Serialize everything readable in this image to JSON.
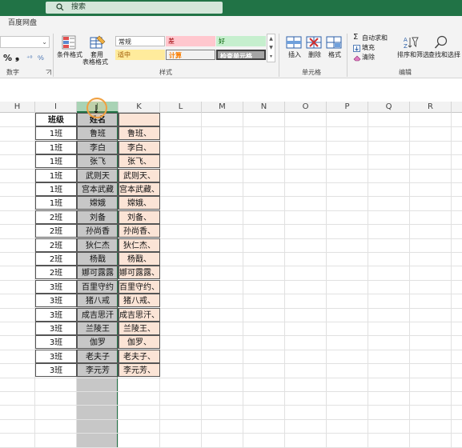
{
  "search": {
    "label": "搜索",
    "icon": "search-icon"
  },
  "menu": {
    "tab": "百度网盘"
  },
  "ribbon": {
    "combo_arrow": "⌄",
    "number": {
      "pct": "%",
      "comma": "❟",
      "inc": "⁺⁰",
      "dec": "⁰⁄₀",
      "label": "数字"
    },
    "cond_format": "条件格式",
    "table_format_1": "套用",
    "table_format_2": "表格格式",
    "styles": {
      "normal": "常规",
      "bad": "差",
      "good": "好",
      "neutral": "适中",
      "calc": "计算",
      "check": "检查单元格",
      "label": "样式"
    },
    "cells": {
      "insert": "插入",
      "delete": "删除",
      "format": "格式",
      "label": "单元格"
    },
    "editing": {
      "autosum": "自动求和",
      "fill": "填充",
      "clear": "清除",
      "sort": "排序和筛选",
      "find": "查找和选择",
      "label": "编辑"
    },
    "colors": {
      "accent": "#217346",
      "bad_bg": "#ffc7ce",
      "good_bg": "#c6efce",
      "neutral_bg": "#ffeb9c"
    }
  },
  "columns": [
    "H",
    "I",
    "J",
    "K",
    "L",
    "M",
    "N",
    "O",
    "P",
    "Q",
    "R"
  ],
  "selected_column": "J",
  "table": {
    "headers": [
      "班级",
      "姓名",
      ""
    ],
    "rows": [
      [
        "1班",
        "鲁班",
        "鲁班、"
      ],
      [
        "1班",
        "李白",
        "李白、"
      ],
      [
        "1班",
        "张飞",
        "张飞、"
      ],
      [
        "1班",
        "武则天",
        "武则天、"
      ],
      [
        "1班",
        "宫本武藏",
        "宫本武藏、"
      ],
      [
        "1班",
        "嫦娥",
        "嫦娥、"
      ],
      [
        "2班",
        "刘备",
        "刘备、"
      ],
      [
        "2班",
        "孙尚香",
        "孙尚香、"
      ],
      [
        "2班",
        "狄仁杰",
        "狄仁杰、"
      ],
      [
        "2班",
        "杨戬",
        "杨戬、"
      ],
      [
        "2班",
        "娜可露露",
        "娜可露露、"
      ],
      [
        "3班",
        "百里守约",
        "百里守约、"
      ],
      [
        "3班",
        "猪八戒",
        "猪八戒、"
      ],
      [
        "3班",
        "成吉思汗",
        "成吉思汗、"
      ],
      [
        "3班",
        "兰陵王",
        "兰陵王、"
      ],
      [
        "3班",
        "伽罗",
        "伽罗、"
      ],
      [
        "3班",
        "老夫子",
        "老夫子、"
      ],
      [
        "3班",
        "李元芳",
        "李元芳、"
      ]
    ]
  }
}
